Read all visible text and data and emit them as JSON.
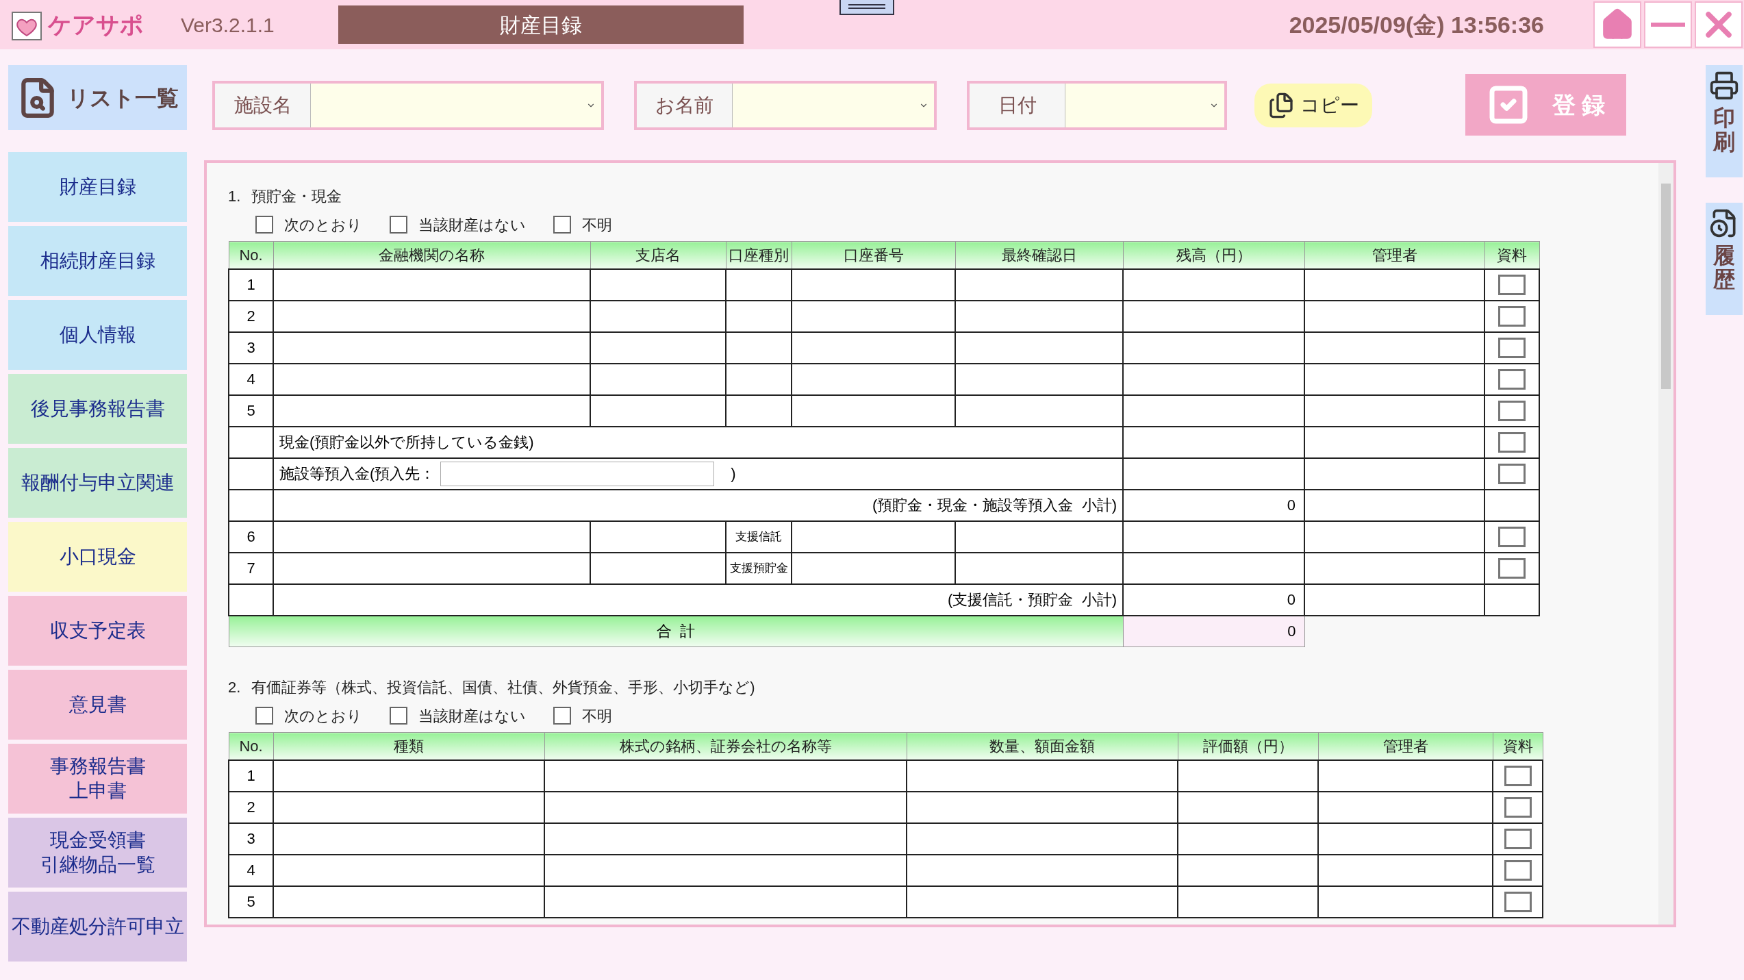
{
  "app": {
    "logo": "ケアサポ",
    "version": "Ver3.2.1.1",
    "title": "財産目録",
    "datetime": "2025/05/09(金) 13:56:36"
  },
  "sidebar": {
    "list_button": "リスト一覧",
    "items": [
      {
        "label": "財産目録",
        "color": "#c5e7f7"
      },
      {
        "label": "相続財産目録",
        "color": "#c5e7f7"
      },
      {
        "label": "個人情報",
        "color": "#c5e7f7"
      },
      {
        "label": "後見事務報告書",
        "color": "#c9ecd2"
      },
      {
        "label": "報酬付与申立関連",
        "color": "#c9ecd2"
      },
      {
        "label": "小口現金",
        "color": "#fbf8c9"
      },
      {
        "label": "収支予定表",
        "color": "#f5c2d6"
      },
      {
        "label": "意見書",
        "color": "#f5c2d6"
      },
      {
        "lines": [
          "事務報告書",
          "上申書"
        ],
        "color": "#f5c2d6"
      },
      {
        "lines": [
          "現金受領書",
          "引継物品一覧"
        ],
        "color": "#dac6e6"
      },
      {
        "label": "不動産処分許可申立",
        "color": "#dac6e6"
      }
    ]
  },
  "filters": [
    {
      "label": "施設名"
    },
    {
      "label": "お名前"
    },
    {
      "label": "日付"
    }
  ],
  "copy_button": "コピー",
  "register_button": "登 録",
  "side_actions": [
    {
      "kind": "print",
      "label": "印刷"
    },
    {
      "kind": "history",
      "label": "履歴"
    }
  ],
  "sections": [
    {
      "number": "1.",
      "title": "預貯金・現金",
      "options": [
        {
          "label": "次のとおり",
          "checked": false
        },
        {
          "label": "当該財産はない",
          "checked": false
        },
        {
          "label": "不明",
          "checked": false
        }
      ],
      "table": {
        "columns": [
          "No.",
          "金融機関の名称",
          "支店名",
          "口座種別",
          "口座番号",
          "最終確認日",
          "残高（円）",
          "管理者",
          "資料"
        ],
        "rows": [
          {
            "kind": "account",
            "no": "1",
            "docs_checked": false
          },
          {
            "kind": "account",
            "no": "2",
            "docs_checked": false
          },
          {
            "kind": "account",
            "no": "3",
            "docs_checked": false
          },
          {
            "kind": "account",
            "no": "4",
            "docs_checked": false
          },
          {
            "kind": "account",
            "no": "5",
            "docs_checked": false
          },
          {
            "kind": "cash",
            "label": "現金(預貯金以外で所持している金銭)",
            "docs_checked": false
          },
          {
            "kind": "deposit",
            "label": "施設等預入金(預入先：",
            "close": ")",
            "docs_checked": false
          },
          {
            "kind": "subtotal",
            "label": "(預貯金・現金・施設等預入金  小計)",
            "value": "0"
          },
          {
            "kind": "account",
            "no": "6",
            "type": "支援信託",
            "docs_checked": false
          },
          {
            "kind": "account",
            "no": "7",
            "type": "支援預貯金",
            "docs_checked": false
          },
          {
            "kind": "subtotal",
            "label": "(支援信託・預貯金  小計)",
            "value": "0"
          },
          {
            "kind": "total",
            "label": "合  計",
            "value": "0"
          }
        ]
      }
    },
    {
      "number": "2.",
      "title": "有価証券等（株式、投資信託、国債、社債、外貨預金、手形、小切手など)",
      "options": [
        {
          "label": "次のとおり",
          "checked": false
        },
        {
          "label": "当該財産はない",
          "checked": false
        },
        {
          "label": "不明",
          "checked": false
        }
      ],
      "table": {
        "columns": [
          "No.",
          "種類",
          "株式の銘柄、証券会社の名称等",
          "数量、額面金額",
          "評価額（円）",
          "管理者",
          "資料"
        ],
        "rows": [
          {
            "kind": "security",
            "no": "1",
            "docs_checked": false
          },
          {
            "kind": "security",
            "no": "2",
            "docs_checked": false
          },
          {
            "kind": "security",
            "no": "3",
            "docs_checked": false
          },
          {
            "kind": "security",
            "no": "4",
            "docs_checked": false
          },
          {
            "kind": "security",
            "no": "5",
            "docs_checked": false
          }
        ]
      }
    }
  ]
}
